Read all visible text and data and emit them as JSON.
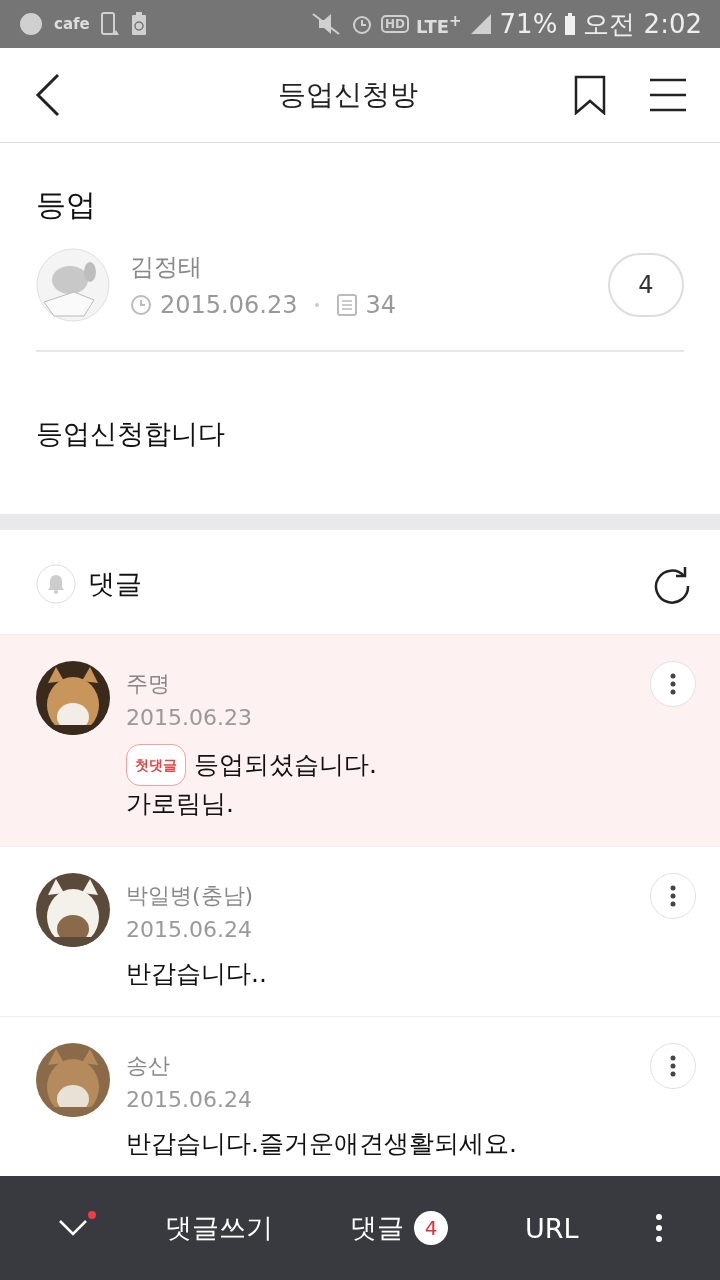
{
  "status_bar": {
    "app_label": "cafe",
    "hd": "HD",
    "network": "LTE$^{+}$",
    "battery": "71%",
    "time": "오전 2:02"
  },
  "header": {
    "title": "등업신청방"
  },
  "post": {
    "title": "등업",
    "author": "김정태",
    "date": "2015.06.23",
    "views": "34",
    "comment_count": "4",
    "body": "등업신청합니다"
  },
  "comments_section": {
    "title": "댓글"
  },
  "comments": [
    {
      "author": "주명",
      "date": "2015.06.23",
      "highlighted": true,
      "badge": "첫댓글",
      "lines": [
        "등업되셨습니다.",
        "가로림님."
      ]
    },
    {
      "author": "박일병(충남)",
      "date": "2015.06.24",
      "highlighted": false,
      "lines": [
        "반갑습니다.."
      ]
    },
    {
      "author": "송산",
      "date": "2015.06.24",
      "highlighted": false,
      "lines": [
        "반갑습니다.즐거운애견생활되세요."
      ]
    }
  ],
  "bottom_bar": {
    "has_new": true,
    "write_label": "댓글쓰기",
    "comments_label": "댓글",
    "comments_count": "4",
    "url_label": "URL"
  }
}
